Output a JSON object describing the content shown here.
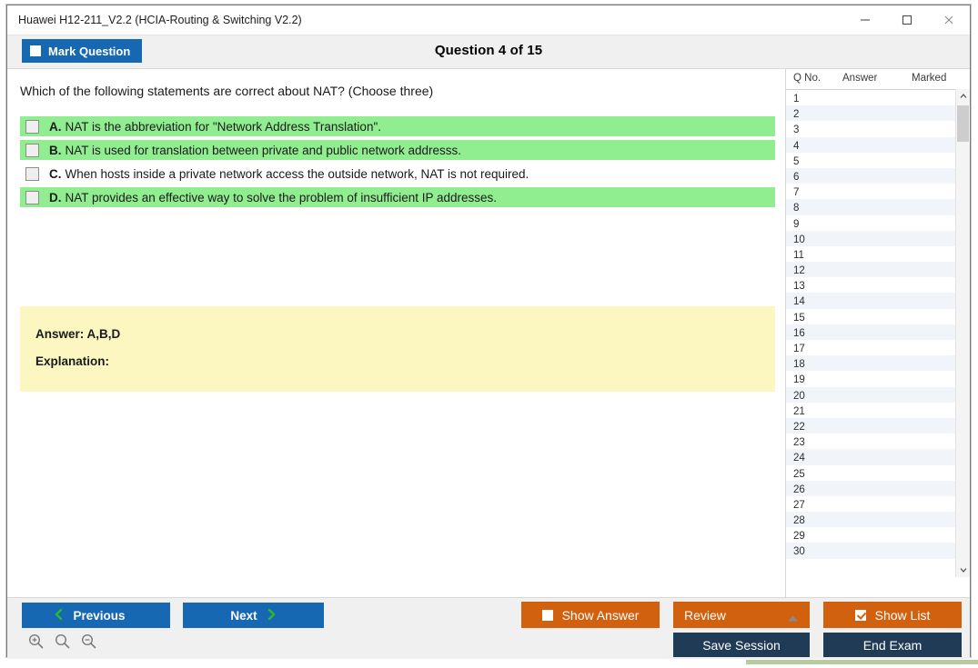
{
  "window": {
    "title": "Huawei H12-211_V2.2 (HCIA-Routing & Switching V2.2)",
    "controls": {
      "minimize": "minimize-icon",
      "maximize": "maximize-icon",
      "close": "close-icon"
    }
  },
  "header": {
    "mark_question_label": "Mark Question",
    "mark_question_checked": false,
    "question_counter": "Question 4 of 15"
  },
  "question": {
    "stem": "Which of the following statements are correct about NAT? (Choose three)",
    "options": [
      {
        "letter": "A.",
        "text": "NAT is the abbreviation for \"Network Address Translation\".",
        "correct": true,
        "checked": false
      },
      {
        "letter": "B.",
        "text": "NAT is used for translation between private and public network addresss.",
        "correct": true,
        "checked": false
      },
      {
        "letter": "C.",
        "text": "When hosts inside a private network access the outside network, NAT is not required.",
        "correct": false,
        "checked": false
      },
      {
        "letter": "D.",
        "text": "NAT provides an effective way to solve the problem of insufficient IP addresses.",
        "correct": true,
        "checked": false
      }
    ],
    "answer_line": "Answer: A,B,D",
    "explanation_line": "Explanation:",
    "explanation_body": ""
  },
  "question_list": {
    "columns": [
      "Q No.",
      "Answer",
      "Marked"
    ],
    "rows": [
      {
        "qno": "1",
        "answer": "",
        "marked": ""
      },
      {
        "qno": "2",
        "answer": "",
        "marked": ""
      },
      {
        "qno": "3",
        "answer": "",
        "marked": ""
      },
      {
        "qno": "4",
        "answer": "",
        "marked": ""
      },
      {
        "qno": "5",
        "answer": "",
        "marked": ""
      },
      {
        "qno": "6",
        "answer": "",
        "marked": ""
      },
      {
        "qno": "7",
        "answer": "",
        "marked": ""
      },
      {
        "qno": "8",
        "answer": "",
        "marked": ""
      },
      {
        "qno": "9",
        "answer": "",
        "marked": ""
      },
      {
        "qno": "10",
        "answer": "",
        "marked": ""
      },
      {
        "qno": "11",
        "answer": "",
        "marked": ""
      },
      {
        "qno": "12",
        "answer": "",
        "marked": ""
      },
      {
        "qno": "13",
        "answer": "",
        "marked": ""
      },
      {
        "qno": "14",
        "answer": "",
        "marked": ""
      },
      {
        "qno": "15",
        "answer": "",
        "marked": ""
      },
      {
        "qno": "16",
        "answer": "",
        "marked": ""
      },
      {
        "qno": "17",
        "answer": "",
        "marked": ""
      },
      {
        "qno": "18",
        "answer": "",
        "marked": ""
      },
      {
        "qno": "19",
        "answer": "",
        "marked": ""
      },
      {
        "qno": "20",
        "answer": "",
        "marked": ""
      },
      {
        "qno": "21",
        "answer": "",
        "marked": ""
      },
      {
        "qno": "22",
        "answer": "",
        "marked": ""
      },
      {
        "qno": "23",
        "answer": "",
        "marked": ""
      },
      {
        "qno": "24",
        "answer": "",
        "marked": ""
      },
      {
        "qno": "25",
        "answer": "",
        "marked": ""
      },
      {
        "qno": "26",
        "answer": "",
        "marked": ""
      },
      {
        "qno": "27",
        "answer": "",
        "marked": ""
      },
      {
        "qno": "28",
        "answer": "",
        "marked": ""
      },
      {
        "qno": "29",
        "answer": "",
        "marked": ""
      },
      {
        "qno": "30",
        "answer": "",
        "marked": ""
      }
    ]
  },
  "footer": {
    "previous_label": "Previous",
    "next_label": "Next",
    "show_answer_label": "Show Answer",
    "show_answer_checked": false,
    "review_label": "Review",
    "show_list_label": "Show List",
    "show_list_checked": true,
    "save_session_label": "Save Session",
    "end_exam_label": "End Exam",
    "zoom_tools": [
      "zoom-in-icon",
      "zoom-reset-icon",
      "zoom-out-icon"
    ]
  },
  "colors": {
    "primary_blue": "#1668b3",
    "accent_orange": "#d1610f",
    "dark_navy": "#1f3b55",
    "correct_green": "#90ee90",
    "answer_yellow": "#fcf7c0",
    "chevron_green": "#2eb82e",
    "header_gray": "#f0f0f0"
  }
}
